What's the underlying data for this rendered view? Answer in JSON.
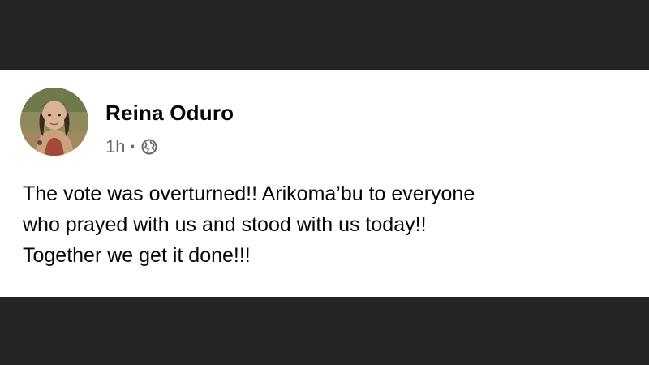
{
  "post": {
    "author": {
      "name": "Reina Oduro",
      "avatar_icon": "profile-photo"
    },
    "timestamp": "1h",
    "separator": "·",
    "audience_icon": "globe-icon",
    "text_lines": [
      "The vote was overturned!! Arikoma’bu to everyone",
      "who prayed with us and stood with us today!!",
      "Together we get it done!!!"
    ]
  },
  "colors": {
    "background": "#242526",
    "card": "#ffffff",
    "text_primary": "#050505",
    "text_secondary": "#65676b"
  }
}
